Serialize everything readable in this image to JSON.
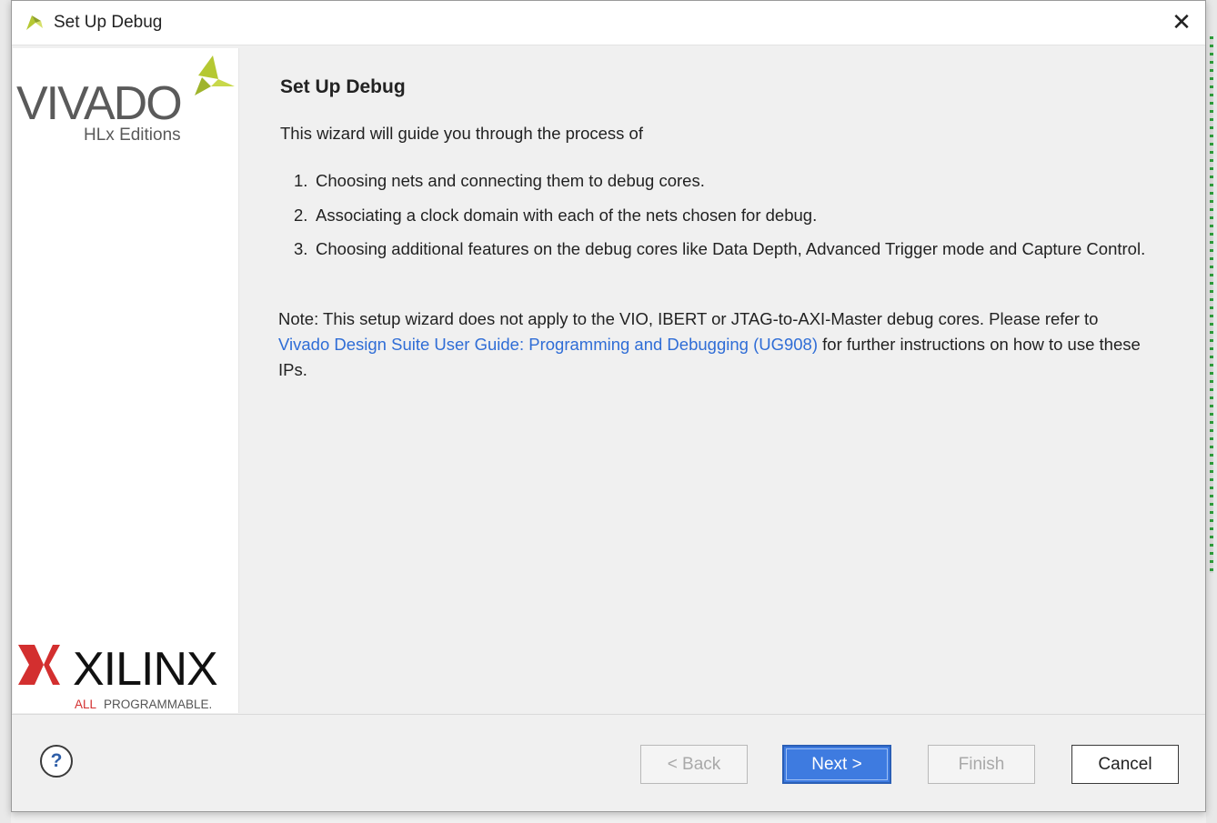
{
  "window": {
    "title": "Set Up Debug",
    "close_icon": "close-icon",
    "app_icon": "vivado-icon"
  },
  "sidebar": {
    "logo_top": {
      "name": "VIVADO",
      "subtitle": "HLx Editions"
    },
    "logo_bottom": {
      "name": "XILINX",
      "tagline_accent": "ALL",
      "tagline": "PROGRAMMABLE."
    }
  },
  "content": {
    "heading": "Set Up Debug",
    "intro": "This wizard will guide you through the process of",
    "steps": [
      {
        "num": "1.",
        "text": "Choosing nets and connecting them to debug cores."
      },
      {
        "num": "2.",
        "text": "Associating a clock domain with each of the nets chosen for debug."
      },
      {
        "num": "3.",
        "text": "Choosing additional features on the debug cores like Data Depth, Advanced Trigger mode and Capture Control."
      }
    ],
    "note_prefix": "Note: This setup wizard does not apply to the VIO, IBERT or JTAG-to-AXI-Master debug cores. Please refer to ",
    "note_link": "Vivado Design Suite User Guide: Programming and Debugging (UG908)",
    "note_suffix": " for further instructions on how to use these IPs."
  },
  "footer": {
    "help_label": "?",
    "back_label": "< Back",
    "next_label": "Next >",
    "finish_label": "Finish",
    "cancel_label": "Cancel"
  },
  "colors": {
    "accent": "#3e7be0",
    "link": "#2f6dd6",
    "xilinx_red": "#d32f2f",
    "vivado_green": "#b5c832"
  }
}
